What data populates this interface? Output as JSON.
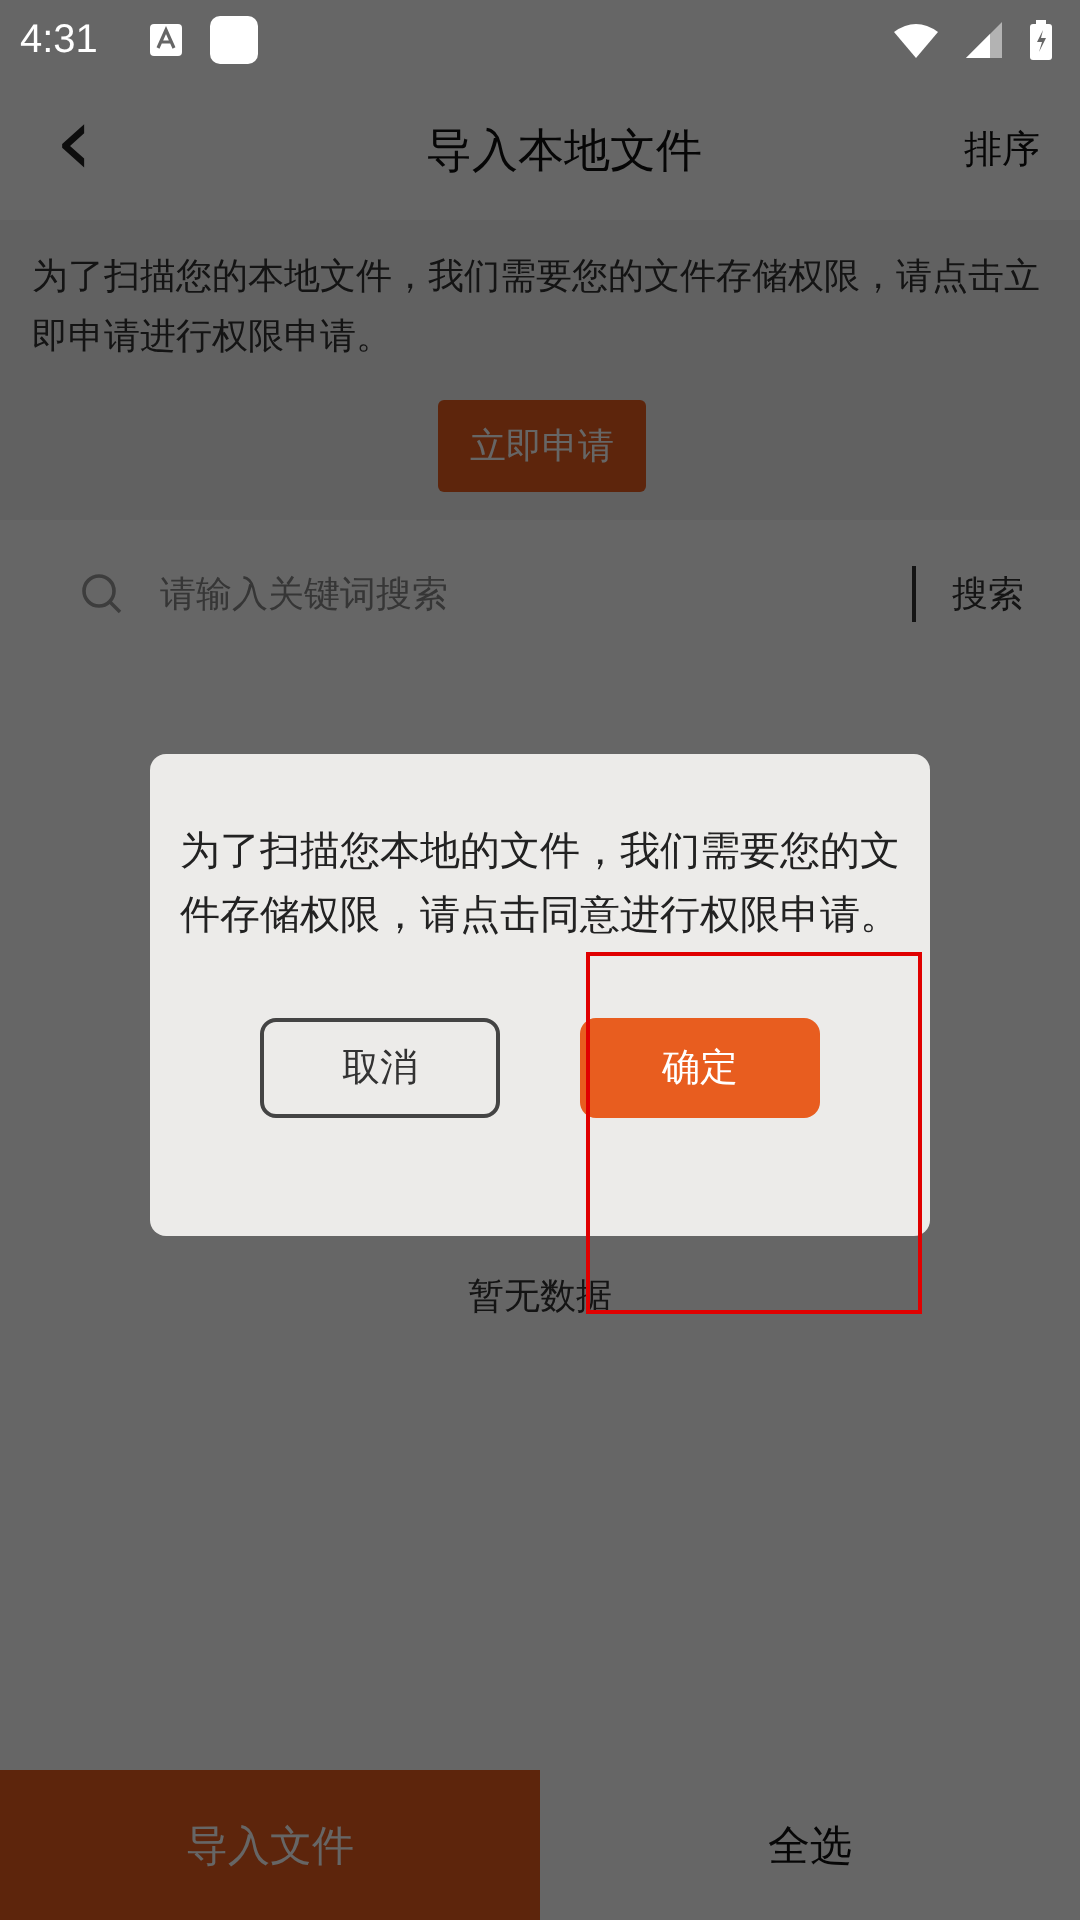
{
  "status_bar": {
    "time": "4:31"
  },
  "toolbar": {
    "back": "‹",
    "title": "导入本地文件",
    "action": "排序"
  },
  "permission_notice": {
    "text": "为了扫描您的本地文件，我们需要您的文件存储权限，请点击立即申请进行权限申请。",
    "button": "立即申请"
  },
  "search": {
    "placeholder": "请输入关键词搜索",
    "button": "搜索"
  },
  "empty_text": "暂无数据",
  "bottom_bar": {
    "import_button": "导入文件",
    "select_all": "全选"
  },
  "dialog": {
    "message": "为了扫描您本地的文件，我们需要您的文件存储权限，请点击同意进行权限申请。",
    "buttons": [
      {
        "label": "取消",
        "kind": "outline"
      },
      {
        "label": "确定",
        "kind": "primary"
      }
    ]
  }
}
